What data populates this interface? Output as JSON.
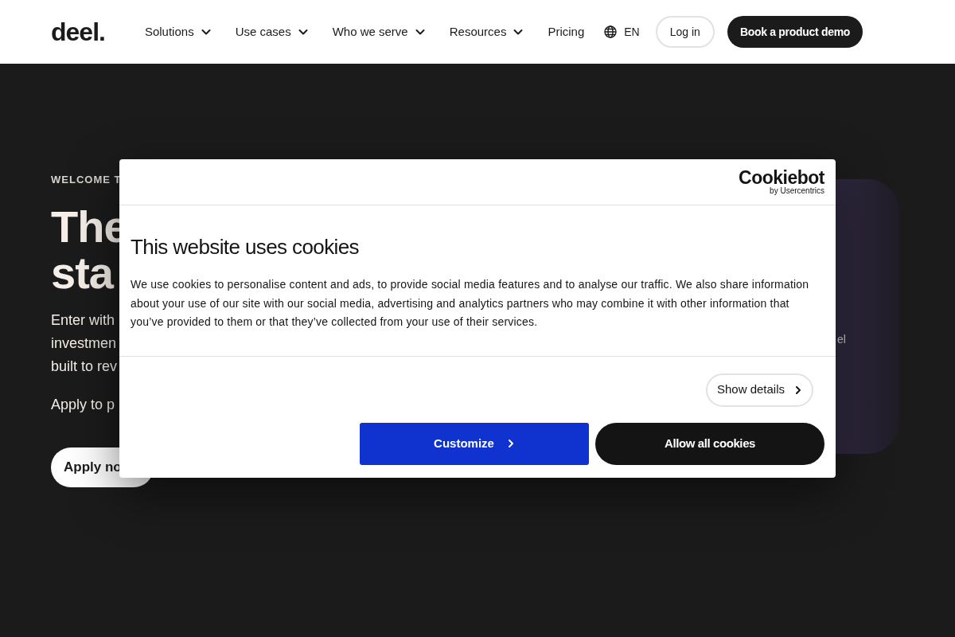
{
  "nav": {
    "logo": "deel.",
    "items": [
      {
        "label": "Solutions",
        "dropdown": true
      },
      {
        "label": "Use cases",
        "dropdown": true
      },
      {
        "label": "Who we serve",
        "dropdown": true
      },
      {
        "label": "Resources",
        "dropdown": true
      },
      {
        "label": "Pricing",
        "dropdown": false
      }
    ],
    "language": "EN",
    "login": "Log in",
    "demo": "Book a product demo"
  },
  "hero": {
    "eyebrow": "WELCOME T",
    "title_lines": [
      "The",
      "sta"
    ],
    "body_lines": [
      "Enter with",
      "investmen",
      "built to rev"
    ],
    "apply_text": "Apply to p",
    "apply_button": "Apply no"
  },
  "side_card": {
    "fragments": [
      "el"
    ]
  },
  "cookie_dialog": {
    "brand": "Cookiebot",
    "brand_sub": "by Usercentrics",
    "title": "This website uses cookies",
    "body": "We use cookies to personalise content and ads, to provide social media features and to analyse our traffic. We also share information about your use of our site with our social media, advertising and analytics partners who may combine it with other information that you’ve provided to them or that they’ve collected from your use of their services.",
    "show_details": "Show details",
    "customize": "Customize",
    "allow_all": "Allow all cookies"
  }
}
